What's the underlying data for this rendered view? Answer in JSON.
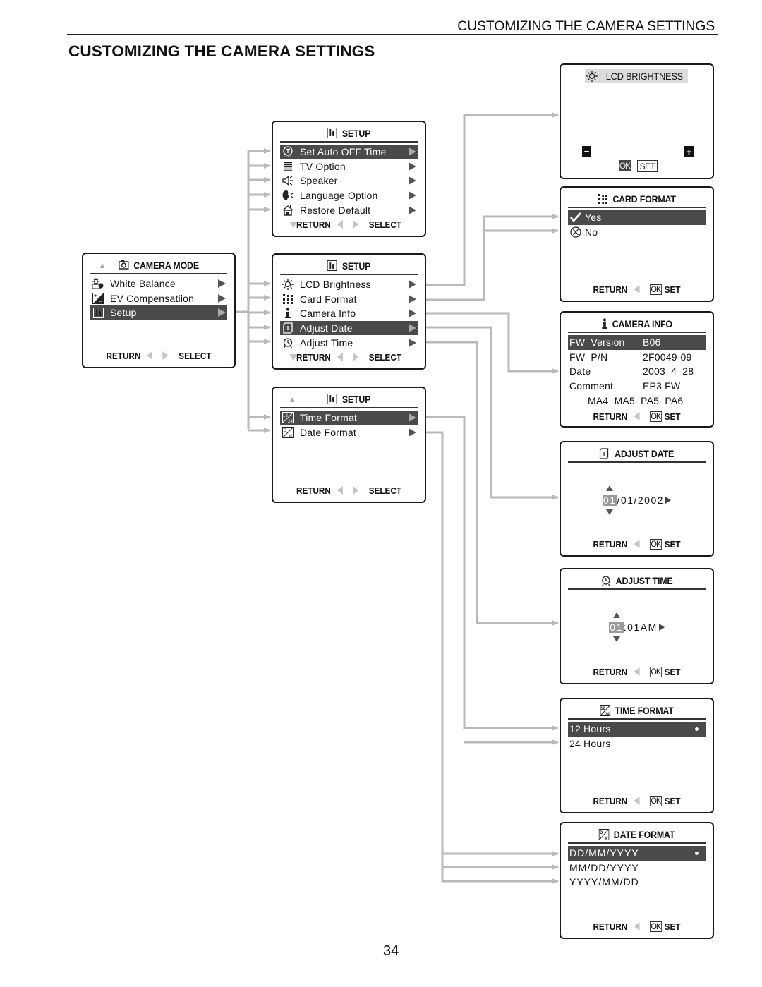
{
  "page": {
    "running_head": "CUSTOMIZING THE CAMERA SETTINGS",
    "title": "CUSTOMIZING THE CAMERA SETTINGS",
    "page_number": "34"
  },
  "colors": {
    "connector": "#b9b9b9",
    "highlight": "#4a4a4a",
    "border": "#1a1a1a"
  },
  "footer_labels": {
    "return": "RETURN",
    "select": "SELECT",
    "set": "SET",
    "ok": "OK"
  },
  "camera_mode": {
    "title": "CAMERA MODE",
    "icon": "camera-icon",
    "items": [
      {
        "label": "White Balance",
        "icon": "white-balance-icon",
        "selected": false
      },
      {
        "label": "EV Compensatiion",
        "icon": "ev-compensation-icon",
        "selected": false
      },
      {
        "label": "Setup",
        "icon": "setup-tools-icon",
        "selected": true
      }
    ]
  },
  "setup_page1": {
    "title": "SETUP",
    "icon": "setup-tools-icon",
    "items": [
      {
        "label": "Set Auto OFF Time",
        "icon": "auto-off-timer-icon",
        "selected": true
      },
      {
        "label": "TV Option",
        "icon": "tv-lines-icon",
        "selected": false
      },
      {
        "label": "Speaker",
        "icon": "speaker-icon",
        "selected": false
      },
      {
        "label": "Language Option",
        "icon": "language-head-icon",
        "selected": false
      },
      {
        "label": "Restore Default",
        "icon": "restore-house-icon",
        "selected": false
      }
    ]
  },
  "setup_page2": {
    "title": "SETUP",
    "icon": "setup-tools-icon",
    "items": [
      {
        "label": "LCD Brightness",
        "icon": "sun-icon",
        "selected": false
      },
      {
        "label": "Card Format",
        "icon": "card-dots-icon",
        "selected": false
      },
      {
        "label": "Camera Info",
        "icon": "info-icon",
        "selected": false
      },
      {
        "label": "Adjust Date",
        "icon": "calendar-icon",
        "selected": true
      },
      {
        "label": "Adjust Time",
        "icon": "alarm-clock-icon",
        "selected": false
      }
    ]
  },
  "setup_page3": {
    "title": "SETUP",
    "icon": "setup-tools-icon",
    "items": [
      {
        "label": "Time Format",
        "icon": "time-format-icon",
        "selected": true
      },
      {
        "label": "Date Format",
        "icon": "date-format-icon",
        "selected": false
      }
    ]
  },
  "lcd_brightness": {
    "title": "LCD BRIGHTNESS",
    "minus": "−",
    "plus": "+",
    "ok": "OK",
    "set": "SET"
  },
  "card_format": {
    "title": "CARD FORMAT",
    "options": [
      {
        "label": "Yes",
        "icon": "checkmark-icon",
        "selected": true
      },
      {
        "label": "No",
        "icon": "cancel-circle-icon",
        "selected": false
      }
    ]
  },
  "camera_info": {
    "title": "CAMERA INFO",
    "rows": [
      {
        "key": "FW  Version",
        "value": "B06",
        "selected": true
      },
      {
        "key": "FW  P/N",
        "value": "2F0049-09",
        "selected": false
      },
      {
        "key": "Date",
        "value": "2003  4  28",
        "selected": false
      },
      {
        "key": "Comment",
        "value": "EP3 FW",
        "selected": false
      }
    ],
    "extra": "MA4  MA5  PA5  PA6"
  },
  "adjust_date": {
    "title": "ADJUST DATE",
    "active_field": "01",
    "rest": "/01/2002"
  },
  "adjust_time": {
    "title": "ADJUST TIME",
    "active_field": "01",
    "rest": ":01AM"
  },
  "time_format": {
    "title": "TIME FORMAT",
    "options": [
      {
        "label": "12 Hours",
        "selected": true
      },
      {
        "label": "24 Hours",
        "selected": false
      }
    ]
  },
  "date_format": {
    "title": "DATE FORMAT",
    "options": [
      {
        "label": "DD/MM/YYYY",
        "selected": true
      },
      {
        "label": "MM/DD/YYYY",
        "selected": false
      },
      {
        "label": "YYYY/MM/DD",
        "selected": false
      }
    ]
  }
}
